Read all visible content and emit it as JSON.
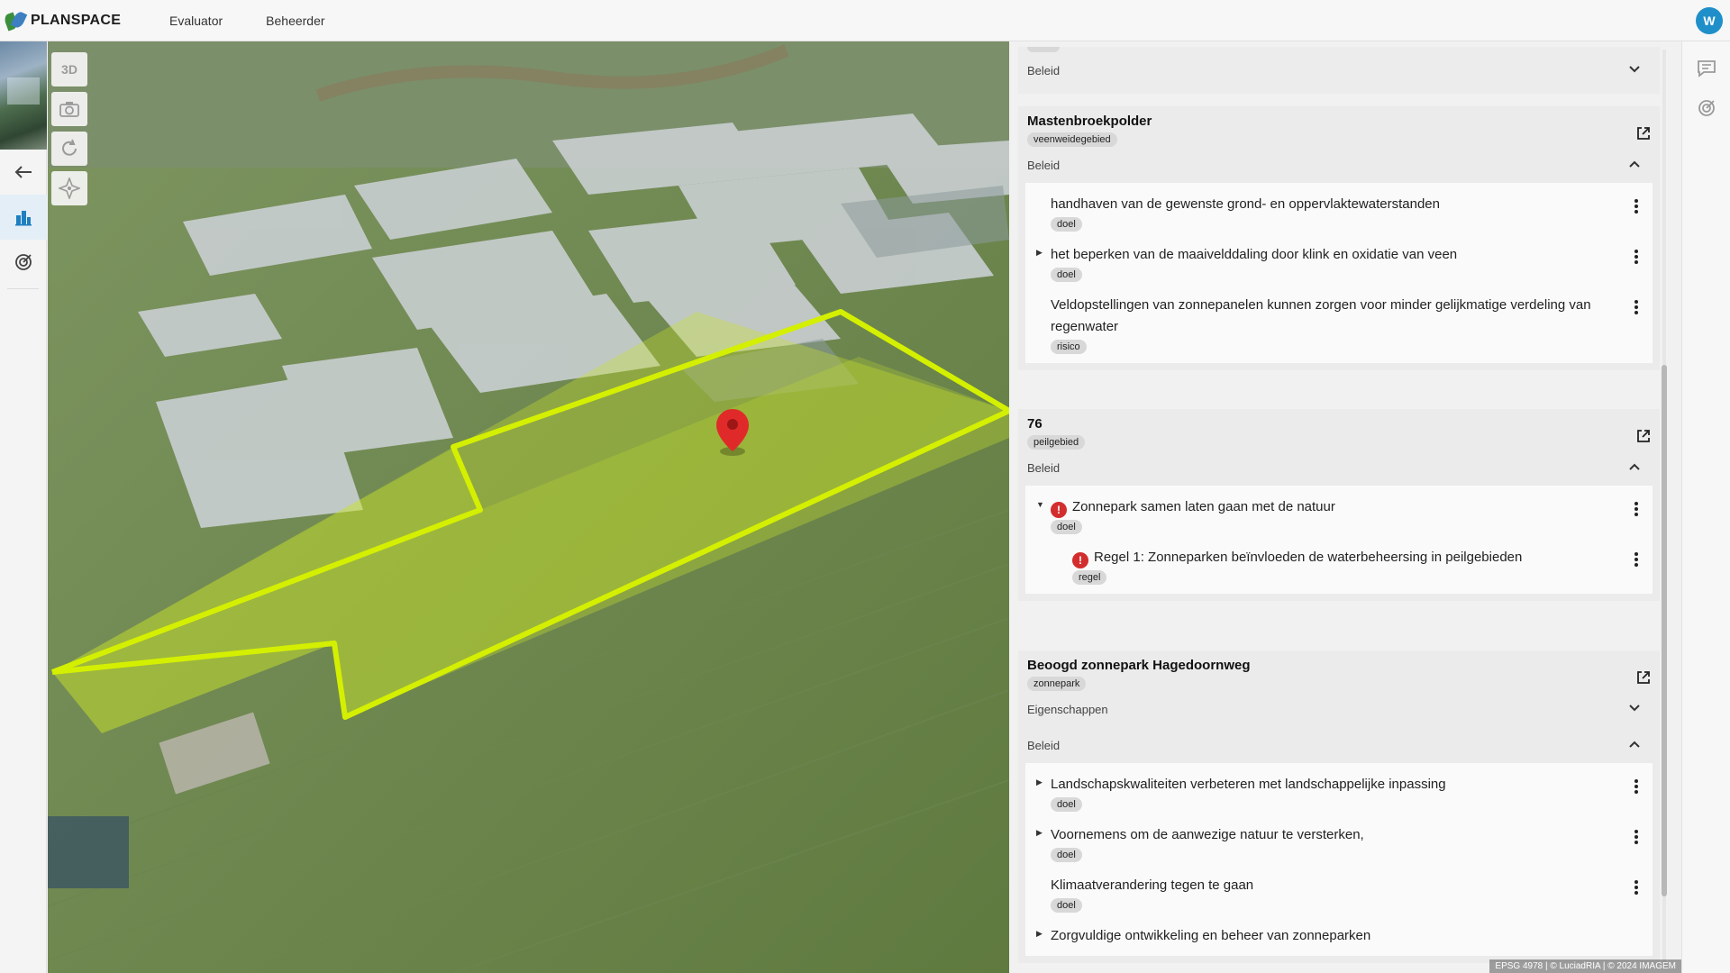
{
  "app": {
    "logo_text": "PLANSPACE",
    "nav": [
      "Evaluator",
      "Beheerder"
    ],
    "user_initial": "W"
  },
  "map": {
    "tools": [
      "3D",
      "camera-icon",
      "rotate-icon",
      "compass-icon"
    ],
    "attribution": "EPSG 4978 | © LuciadRIA | © 2024 IMAGEM"
  },
  "panel": {
    "top_section": "Beleid",
    "cards": [
      {
        "title": "Mastenbroekpolder",
        "tag": "veenweidegebied",
        "sections": [
          {
            "label": "Beleid",
            "items": [
              {
                "text": "handhaven van de gewenste grond- en oppervlaktewaterstanden",
                "tag": "doel"
              },
              {
                "text": "het beperken van de maaivelddaling door klink en oxidatie van veen",
                "tag": "doel"
              },
              {
                "text": "Veldopstellingen van zonnepanelen kunnen zorgen voor minder gelijkmatige verdeling van regenwater",
                "tag": "risico"
              }
            ]
          }
        ]
      },
      {
        "title": "76",
        "tag": "peilgebied",
        "sections": [
          {
            "label": "Beleid",
            "items": [
              {
                "text": "Zonnepark samen laten gaan met de natuur",
                "tag": "doel"
              },
              {
                "text": "Regel 1: Zonneparken beïnvloeden de waterbeheersing in peilgebieden",
                "tag": "regel"
              }
            ]
          }
        ]
      },
      {
        "title": "Beoogd zonnepark Hagedoornweg",
        "tag": "zonnepark",
        "sections": [
          {
            "label": "Eigenschappen"
          },
          {
            "label": "Beleid",
            "items": [
              {
                "text": "Landschapskwaliteiten verbeteren met landschappelijke inpassing",
                "tag": "doel"
              },
              {
                "text": "Voornemens om de aanwezige natuur te versterken,",
                "tag": "doel"
              },
              {
                "text": "Klimaatverandering tegen te gaan",
                "tag": "doel"
              },
              {
                "text": "Zorgvuldige ontwikkeling en beheer van zonneparken",
                "tag": ""
              }
            ]
          }
        ]
      }
    ]
  },
  "colors": {
    "accent": "#1f8fc9",
    "parcel_outline": "#d4f000",
    "marker": "#e02a2a",
    "warning": "#d32d2d"
  }
}
